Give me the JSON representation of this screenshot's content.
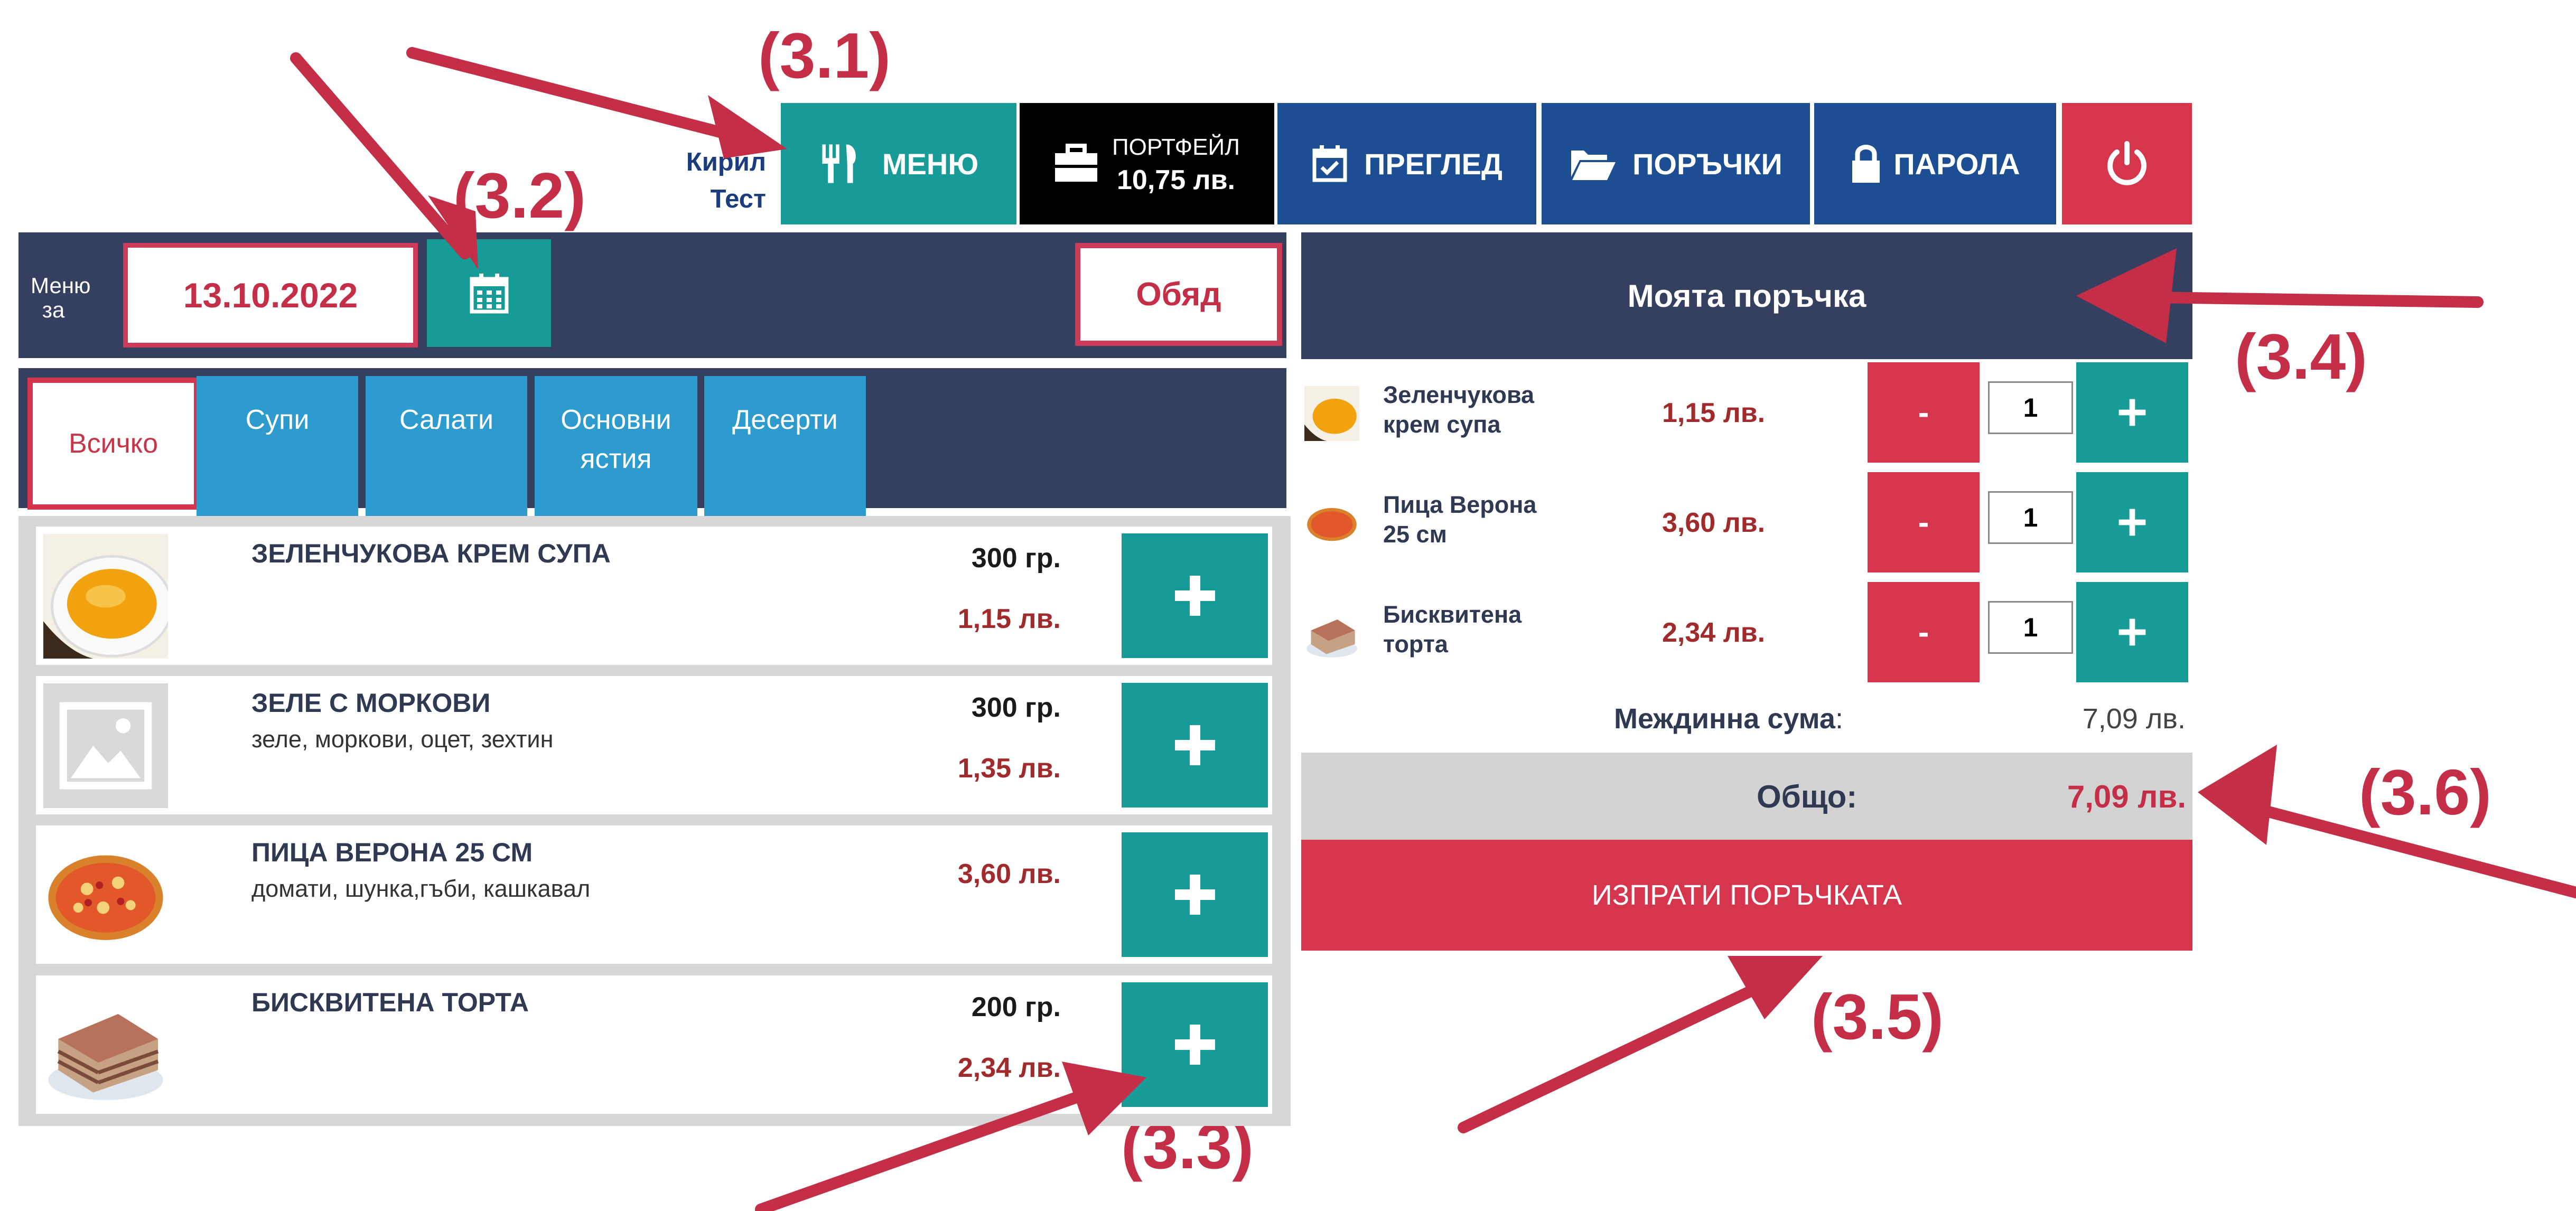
{
  "user": {
    "first": "Кирил",
    "last": "Тест"
  },
  "nav": {
    "menu": "МЕНЮ",
    "wallet_label": "ПОРТФЕЙЛ",
    "wallet_amount": "10,75 лв.",
    "review": "ПРЕГЛЕД",
    "orders": "ПОРЪЧКИ",
    "password": "ПАРОЛА"
  },
  "menu_for": {
    "label_line1": "Меню",
    "label_line2": "за",
    "date": "13.10.2022",
    "meal": "Обяд"
  },
  "tabs": [
    {
      "label": "Всичко",
      "active": true
    },
    {
      "label": "Супи"
    },
    {
      "label": "Салати"
    },
    {
      "label_line1": "Основни",
      "label_line2": "ястия"
    },
    {
      "label": "Десерти"
    }
  ],
  "items": [
    {
      "name": "ЗЕЛЕНЧУКОВА КРЕМ СУПА",
      "desc": "",
      "weight": "300 гр.",
      "price": "1,15 лв.",
      "icon": "soup-image"
    },
    {
      "name": "ЗЕЛЕ С МОРКОВИ",
      "desc": "зеле, моркови, оцет, зехтин",
      "weight": "300 гр.",
      "price": "1,35 лв.",
      "icon": "placeholder-image-icon"
    },
    {
      "name": "ПИЦА ВЕРОНА 25 СМ",
      "desc": "домати, шунка,гъби, кашкавал",
      "weight": "",
      "price": "3,60 лв.",
      "icon": "pizza-image"
    },
    {
      "name": "БИСКВИТЕНА ТОРТА",
      "desc": "",
      "weight": "200 гр.",
      "price": "2,34 лв.",
      "icon": "cake-image"
    }
  ],
  "order": {
    "title": "Моята поръчка",
    "rows": [
      {
        "name_line1": "Зеленчукова",
        "name_line2": "крем супа",
        "price": "1,15 лв.",
        "qty": "1",
        "minus": "-"
      },
      {
        "name_line1": "Пица Верона",
        "name_line2": "25 см",
        "price": "3,60 лв.",
        "qty": "1",
        "minus": "-"
      },
      {
        "name_line1": "Бисквитена",
        "name_line2": "торта",
        "price": "2,34 лв.",
        "qty": "1",
        "minus": "-"
      }
    ],
    "subtotal_label": "Междинна сума",
    "subtotal_colon": ":",
    "subtotal_value": "7,09 лв.",
    "total_label": "Общо:",
    "total_value": "7,09 лв.",
    "send_label": "ИЗПРАТИ ПОРЪЧКАТА"
  },
  "annotations": {
    "a31": "(3.1)",
    "a32": "(3.2)",
    "a33": "(3.3)",
    "a34": "(3.4)",
    "a35": "(3.5)",
    "a36": "(3.6)"
  },
  "colors": {
    "teal": "#179b96",
    "navy": "#1d4e94",
    "dark_bar": "#353f60",
    "red": "#d5364e",
    "annotation": "#c42e46"
  }
}
